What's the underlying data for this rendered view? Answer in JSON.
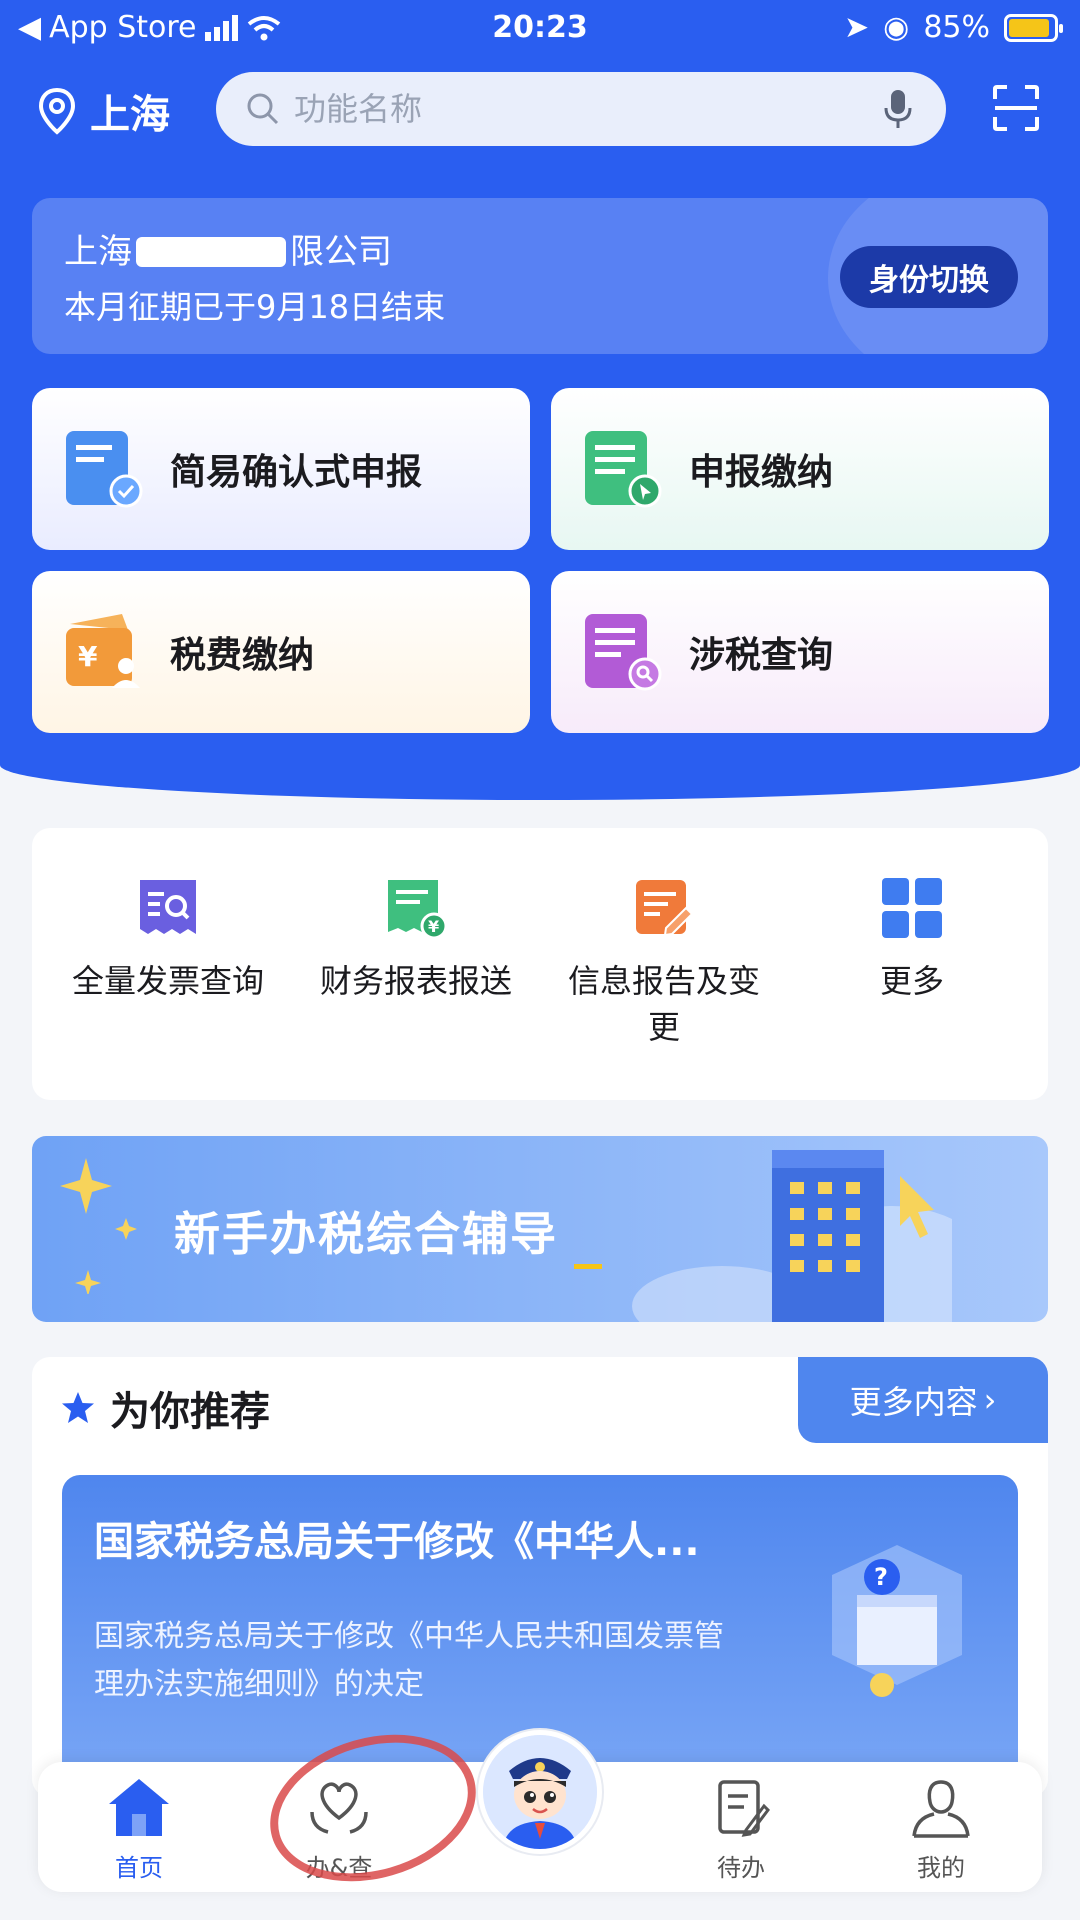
{
  "status_bar": {
    "back_app": "App Store",
    "time": "20:23",
    "battery": "85%"
  },
  "header": {
    "location": "上海",
    "search_placeholder": "功能名称"
  },
  "company": {
    "name_prefix": "上海",
    "name_suffix": "限公司",
    "period_text": "本月征期已于9月18日结束",
    "switch_label": "身份切换"
  },
  "main_tiles": [
    {
      "label": "简易确认式申报",
      "icon": "document-check-icon",
      "color": "#4a8ff0"
    },
    {
      "label": "申报缴纳",
      "icon": "list-cursor-icon",
      "color": "#3fbf7f"
    },
    {
      "label": "税费缴纳",
      "icon": "wallet-yuan-icon",
      "color": "#f29a3a"
    },
    {
      "label": "涉税查询",
      "icon": "document-search-icon",
      "color": "#b25bd6"
    }
  ],
  "quick_services": [
    {
      "label": "全量发票查询",
      "icon": "invoice-search-icon",
      "color": "#6a5fe0"
    },
    {
      "label": "财务报表报送",
      "icon": "report-yuan-icon",
      "color": "#3fbf7f"
    },
    {
      "label": "信息报告及变更",
      "icon": "edit-report-icon",
      "color": "#f07a3a"
    },
    {
      "label": "更多",
      "icon": "grid-more-icon",
      "color": "#3f7cf0"
    }
  ],
  "banner": {
    "text": "新手办税综合辅导"
  },
  "recommend": {
    "title": "为你推荐",
    "more_label": "更多内容",
    "card_title": "国家税务总局关于修改《中华人...",
    "card_desc": "国家税务总局关于修改《中华人民共和国发票管理办法实施细则》的决定"
  },
  "tabs": [
    {
      "label": "首页",
      "icon": "home-icon",
      "active": true
    },
    {
      "label": "办&查",
      "icon": "heart-hand-icon",
      "active": false
    },
    {
      "label": "待办",
      "icon": "todo-icon",
      "active": false
    },
    {
      "label": "我的",
      "icon": "user-icon",
      "active": false
    }
  ],
  "colors": {
    "brand_blue": "#2a5ef0",
    "annotation_red": "#d94a4a"
  }
}
